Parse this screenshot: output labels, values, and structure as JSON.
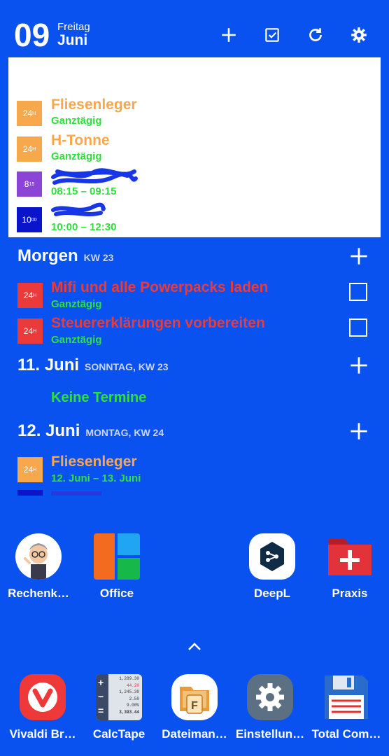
{
  "header": {
    "day": "09",
    "weekday": "Freitag",
    "month": "Juni"
  },
  "today": [
    {
      "badge": "24",
      "badge_sup": "H",
      "color": "#f8a84c",
      "title": "Fliesenleger",
      "sub": "Ganztägig"
    },
    {
      "badge": "24",
      "badge_sup": "H",
      "color": "#f8a84c",
      "title": "H-Tonne",
      "sub": "Ganztägig"
    },
    {
      "badge": "8",
      "badge_sup": "15",
      "color": "#8c44d6",
      "title": "",
      "sub": "08:15 – 09:15"
    },
    {
      "badge": "10",
      "badge_sup": "00",
      "color": "#0a14c8",
      "title": "",
      "sub": "10:00 – 12:30"
    }
  ],
  "tomorrow": {
    "title": "Morgen",
    "sub": "KW 23",
    "items": [
      {
        "badge": "24",
        "badge_sup": "H",
        "title": "Mifi und alle Powerpacks laden",
        "sub": "Ganztägig"
      },
      {
        "badge": "24",
        "badge_sup": "H",
        "title": "Steuererklärungen vorbereiten",
        "sub": "Ganztägig"
      }
    ]
  },
  "day11": {
    "title": "11. Juni",
    "sub": "SONNTAG,  KW 23",
    "empty": "Keine Termine"
  },
  "day12": {
    "title": "12. Juni",
    "sub": "MONTAG,  KW 24",
    "items": [
      {
        "badge": "24",
        "badge_sup": "H",
        "title": "Fliesenleger",
        "sub": "12. Juni – 13. Juni"
      }
    ]
  },
  "apps_row1": [
    "Rechenk…",
    "Office",
    "DeepL",
    "Praxis"
  ],
  "dock": [
    "Vivaldi Br…",
    "CalcTape",
    "Dateiman…",
    "Einstellun…",
    "Total Com…"
  ],
  "calctape_lines": [
    "1,289.30",
    "44.20",
    "1,245.30",
    "2.50",
    "9.00%",
    "3,393.44"
  ]
}
